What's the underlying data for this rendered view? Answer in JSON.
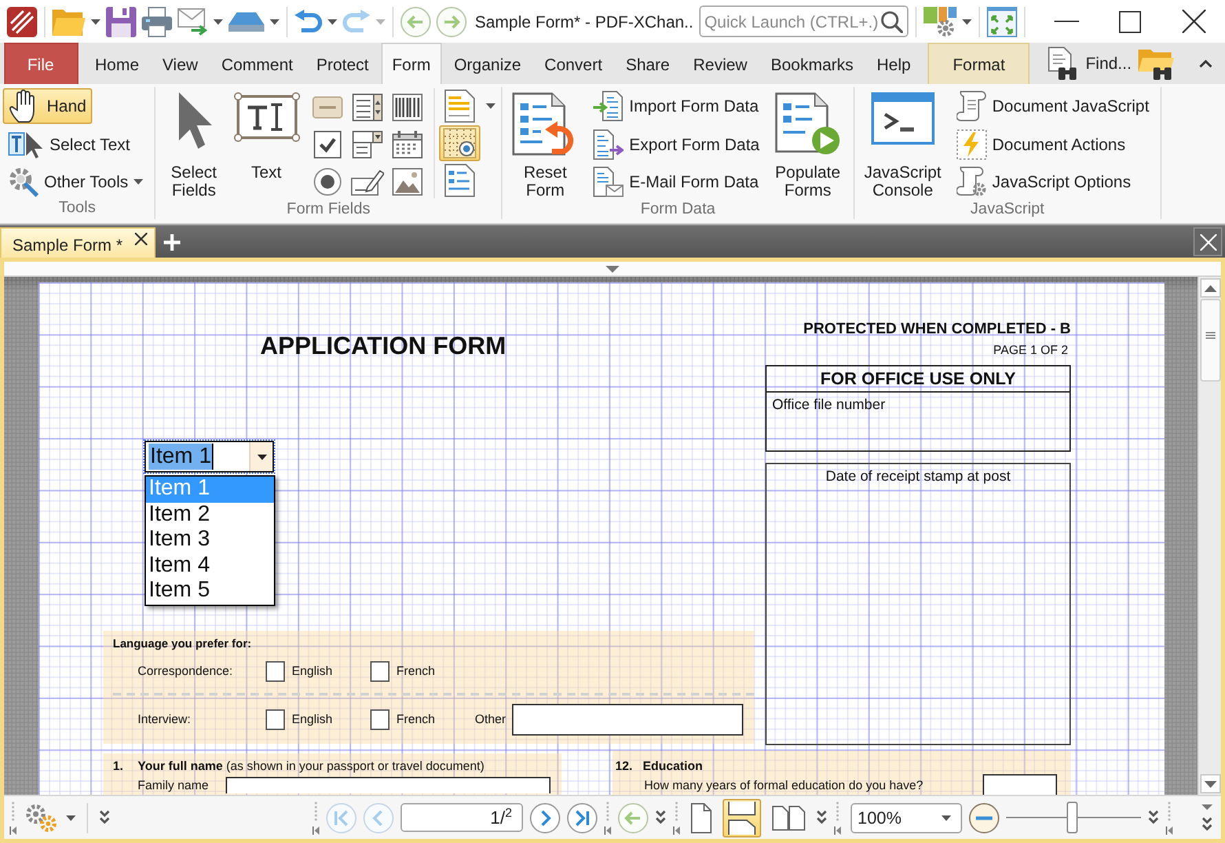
{
  "title_bar": {
    "title": "Sample Form* - PDF-XChan..",
    "quick_launch": {
      "placeholder": "Quick Launch (CTRL+.)"
    }
  },
  "menu_tabs": [
    {
      "label": "File",
      "kind": "file",
      "selected": false
    },
    {
      "label": "Home",
      "kind": "tab",
      "selected": false
    },
    {
      "label": "View",
      "kind": "tab",
      "selected": false
    },
    {
      "label": "Comment",
      "kind": "tab",
      "selected": false
    },
    {
      "label": "Protect",
      "kind": "tab",
      "selected": false
    },
    {
      "label": "Form",
      "kind": "tab",
      "selected": true
    },
    {
      "label": "Organize",
      "kind": "tab",
      "selected": false
    },
    {
      "label": "Convert",
      "kind": "tab",
      "selected": false
    },
    {
      "label": "Share",
      "kind": "tab",
      "selected": false
    },
    {
      "label": "Review",
      "kind": "tab",
      "selected": false
    },
    {
      "label": "Bookmarks",
      "kind": "tab",
      "selected": false
    },
    {
      "label": "Help",
      "kind": "tab",
      "selected": false
    },
    {
      "label": "Format",
      "kind": "context",
      "selected": false
    }
  ],
  "find": {
    "label": "Find..."
  },
  "ribbon": {
    "groups": [
      {
        "title": "Tools",
        "items": [
          {
            "kind": "small",
            "label": "Hand",
            "selected": true
          },
          {
            "kind": "small",
            "label": "Select Text",
            "selected": false
          },
          {
            "kind": "small",
            "label": "Other Tools",
            "selected": false,
            "dropdown": true
          }
        ]
      },
      {
        "title": "Form Fields",
        "items": [
          {
            "kind": "large",
            "label": "Select Fields"
          },
          {
            "kind": "large",
            "label": "Text"
          },
          {
            "kind": "field_icons"
          },
          {
            "kind": "toggles",
            "toggles": [
              {
                "on": false
              },
              {
                "on": true
              },
              {
                "on": false
              }
            ]
          }
        ]
      },
      {
        "title": "Form Data",
        "items": [
          {
            "kind": "large",
            "label": "Reset Form"
          },
          {
            "kind": "small",
            "label": "Import Form Data"
          },
          {
            "kind": "small",
            "label": "Export Form Data"
          },
          {
            "kind": "small",
            "label": "E-Mail Form Data"
          },
          {
            "kind": "large",
            "label": "Populate Forms"
          }
        ]
      },
      {
        "title": "JavaScript",
        "items": [
          {
            "kind": "large",
            "label": "JavaScript Console"
          },
          {
            "kind": "small",
            "label": "Document JavaScript"
          },
          {
            "kind": "small",
            "label": "Document Actions"
          },
          {
            "kind": "small",
            "label": "JavaScript Options"
          }
        ]
      }
    ]
  },
  "doc_tabs": [
    {
      "label": "Sample Form *",
      "selected": true
    }
  ],
  "document": {
    "title": "APPLICATION FORM",
    "protection": "PROTECTED WHEN COMPLETED - B",
    "page_label": "PAGE 1 OF 2",
    "office_box": {
      "heading": "FOR OFFICE USE ONLY",
      "field_label": "Office file number"
    },
    "stamp_box": {
      "label": "Date of receipt stamp at post"
    },
    "combo": {
      "value": "Item 1",
      "expanded": true,
      "options": [
        {
          "label": "Item 1",
          "selected": true
        },
        {
          "label": "Item 2",
          "selected": false
        },
        {
          "label": "Item 3",
          "selected": false
        },
        {
          "label": "Item 4",
          "selected": false
        },
        {
          "label": "Item 5",
          "selected": false
        }
      ]
    },
    "language": {
      "heading": "Language you prefer for:",
      "rows": [
        {
          "label": "Correspondence:",
          "options": [
            {
              "label": "English",
              "checked": false
            },
            {
              "label": "French",
              "checked": false
            }
          ]
        },
        {
          "label": "Interview:",
          "options": [
            {
              "label": "English",
              "checked": false
            },
            {
              "label": "French",
              "checked": false
            }
          ],
          "other": {
            "label": "Other"
          }
        }
      ]
    },
    "full_name": {
      "number": "1.",
      "heading": "**Your full name** (as shown in your passport or travel document)",
      "fields": [
        {
          "label": "Family name"
        }
      ]
    },
    "education": {
      "number": "12.",
      "heading": "Education",
      "question": "How many years of formal education do you have?"
    }
  },
  "status_bar": {
    "page": "1/$^{2}$",
    "view_modes": [
      {
        "selected": false
      },
      {
        "selected": true
      },
      {
        "selected": false
      }
    ],
    "zoom": "100%",
    "zoom_slider": {
      "level": 0.49
    }
  }
}
